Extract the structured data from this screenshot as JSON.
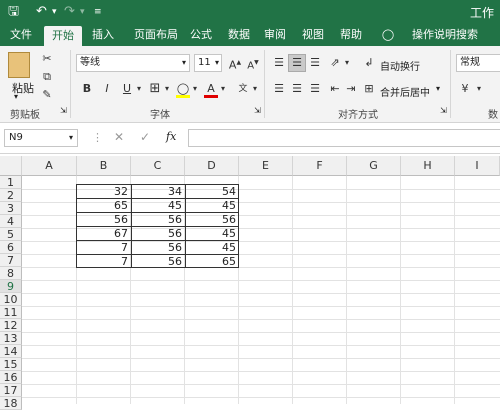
{
  "titlebar": {
    "title": "工作"
  },
  "tabs": [
    {
      "label": "文件"
    },
    {
      "label": "开始"
    },
    {
      "label": "插入"
    },
    {
      "label": "页面布局"
    },
    {
      "label": "公式"
    },
    {
      "label": "数据"
    },
    {
      "label": "审阅"
    },
    {
      "label": "视图"
    },
    {
      "label": "帮助"
    },
    {
      "label": "操作说明搜索"
    }
  ],
  "ribbon": {
    "clipboard": {
      "paste_label": "粘贴",
      "group_label": "剪贴板"
    },
    "font": {
      "font_name": "等线",
      "font_size": "11",
      "bold": "B",
      "italic": "I",
      "underline": "U",
      "font_color_letter": "A",
      "group_label": "字体"
    },
    "alignment": {
      "wrap_label": "自动换行",
      "merge_label": "合并后居中",
      "group_label": "对齐方式"
    },
    "number": {
      "format": "常规",
      "group_label": "数"
    }
  },
  "formula_bar": {
    "name_box": "N9",
    "cancel": "✕",
    "enter": "✓",
    "fx": "fx",
    "value": ""
  },
  "grid": {
    "columns": [
      "A",
      "B",
      "C",
      "D",
      "E",
      "F",
      "G",
      "H",
      "I"
    ],
    "rows": [
      "1",
      "2",
      "3",
      "4",
      "5",
      "6",
      "7",
      "8",
      "9",
      "10",
      "11",
      "12",
      "13",
      "14",
      "15",
      "16",
      "17",
      "18"
    ],
    "selected_row": "9",
    "data": [
      [
        "32",
        "34",
        "54"
      ],
      [
        "65",
        "45",
        "45"
      ],
      [
        "56",
        "56",
        "56"
      ],
      [
        "67",
        "56",
        "45"
      ],
      [
        "7",
        "56",
        "45"
      ],
      [
        "7",
        "56",
        "65"
      ]
    ]
  },
  "colors": {
    "accent": "#217346",
    "font_red": "#e00000",
    "highlight_yellow": "#ffff00"
  }
}
